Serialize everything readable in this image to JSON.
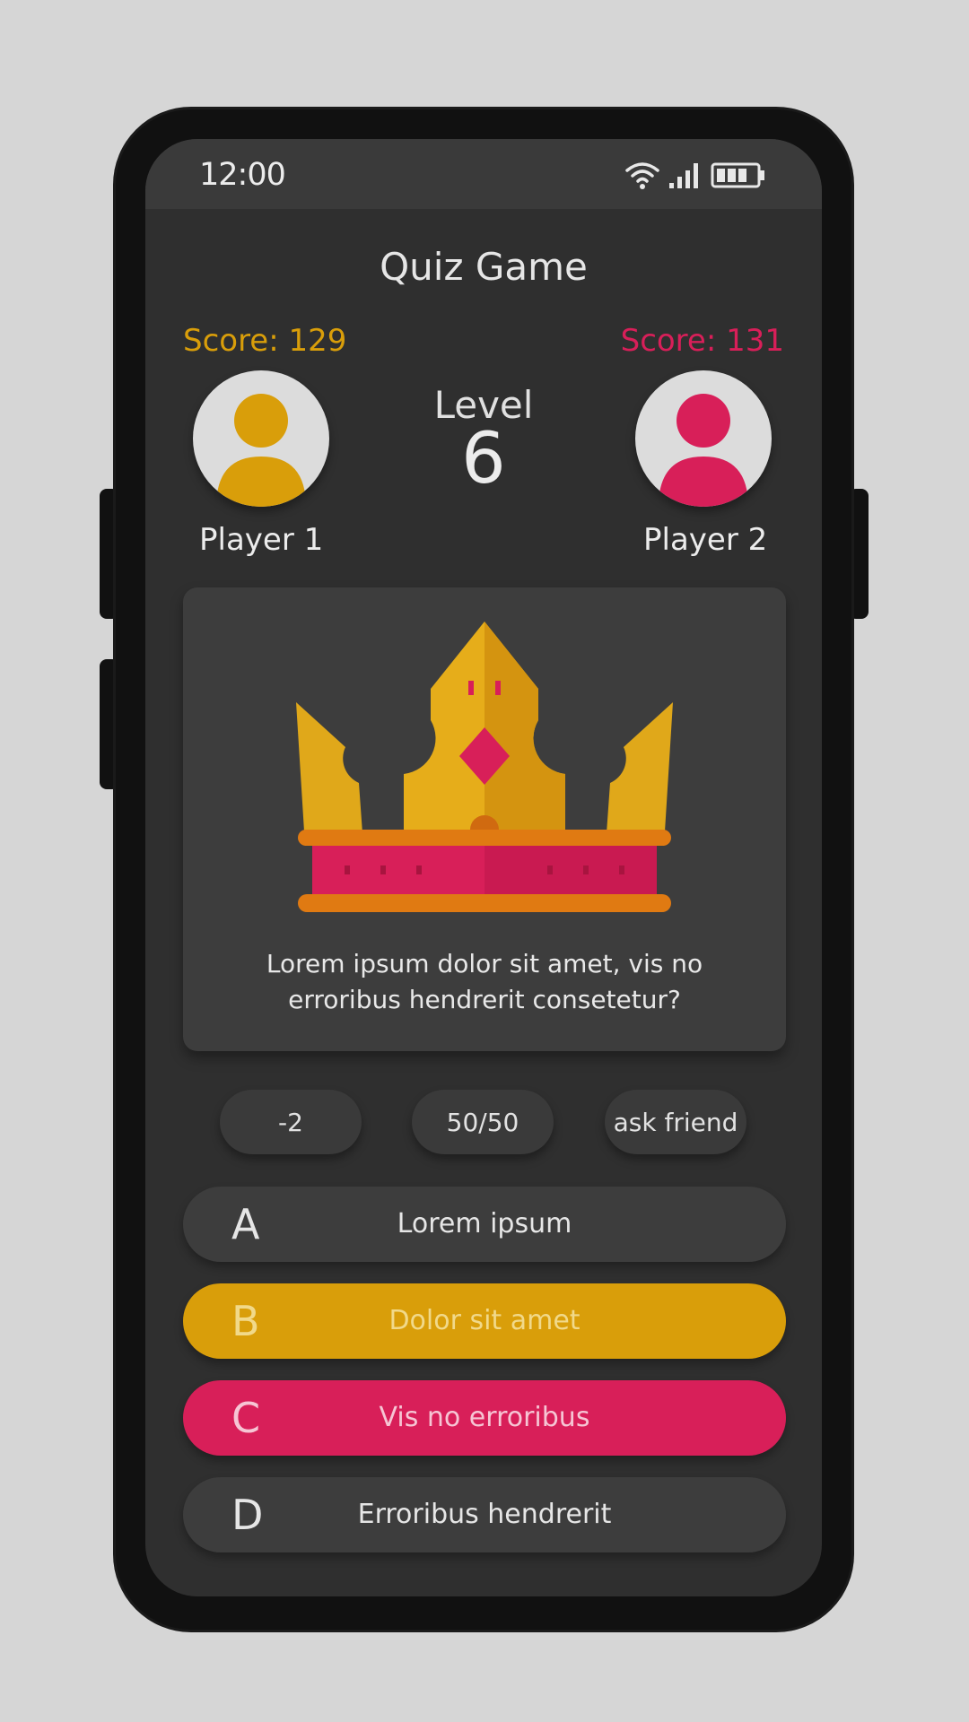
{
  "status": {
    "time": "12:00"
  },
  "header": {
    "title": "Quiz Game"
  },
  "players": [
    {
      "name": "Player 1",
      "score": "Score: 129",
      "color": "#d99e0a"
    },
    {
      "name": "Player 2",
      "score": "Score: 131",
      "color": "#d81f59"
    }
  ],
  "level": {
    "label": "Level",
    "value": "6"
  },
  "question": {
    "text": "Lorem ipsum dolor sit amet, vis no erroribus hendrerit consetetur?"
  },
  "lifelines": [
    "-2",
    "50/50",
    "ask friend"
  ],
  "answers": [
    {
      "letter": "A",
      "text": "Lorem ipsum"
    },
    {
      "letter": "B",
      "text": "Dolor sit amet",
      "color": "#d99e0a"
    },
    {
      "letter": "C",
      "text": "Vis no erroribus",
      "color": "#d81f59"
    },
    {
      "letter": "D",
      "text": "Erroribus hendrerit"
    }
  ],
  "icons": {
    "wifi": "wifi-icon",
    "signal": "signal-icon",
    "battery": "battery-icon",
    "crown": "crown-icon",
    "avatar": "user-icon"
  }
}
